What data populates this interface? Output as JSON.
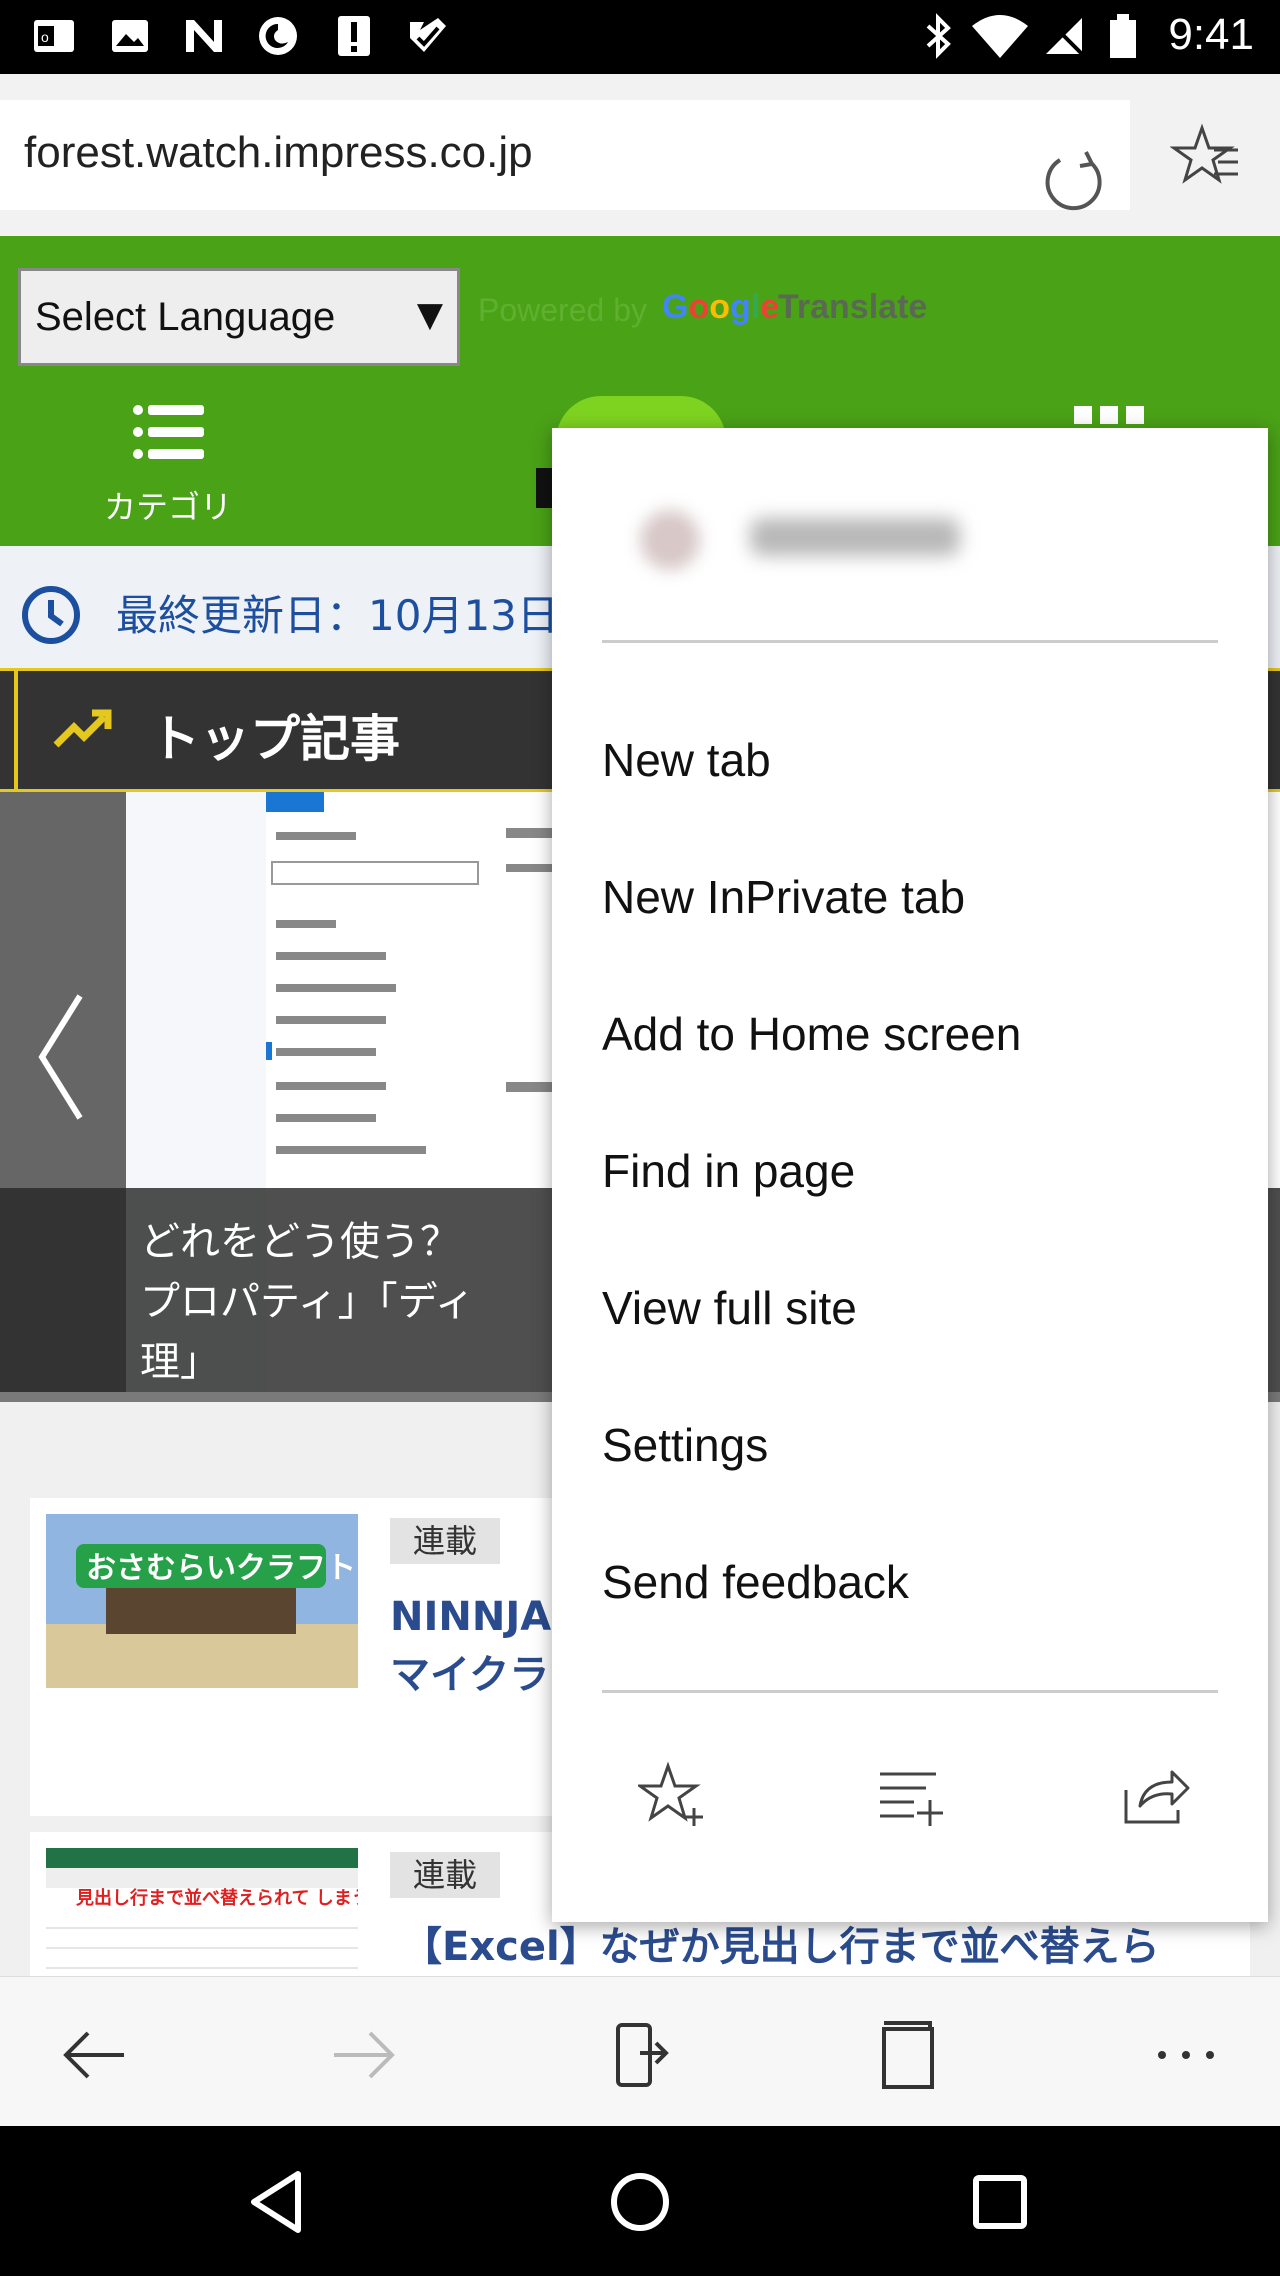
{
  "status_bar": {
    "time": "9:41",
    "left_icons": [
      "outlook-icon",
      "gallery-icon",
      "n-app-icon",
      "firefox-icon",
      "alert-icon",
      "check-icon"
    ],
    "right_icons": [
      "bluetooth-icon",
      "wifi-icon",
      "no-signal-icon",
      "battery-icon"
    ]
  },
  "browser": {
    "url": "forest.watch.impress.co.jp"
  },
  "page": {
    "language_select": "Select Language",
    "powered_by": "Powered by",
    "google": [
      "G",
      "o",
      "o",
      "g",
      "l",
      "e"
    ],
    "translate": "Translate",
    "category_label": "カテゴリ",
    "last_updated": "最終更新日：10月13日",
    "top_articles": "トップ記事",
    "carousel_caption": "どれをどう使う？\nプロパティ」「ディ\n理」",
    "articles": [
      {
        "tag": "連載",
        "title": "NINNJA\nマイクラ",
        "thumb_text": "おさむらいクラフト"
      },
      {
        "tag": "連載",
        "title": "【Excel】なぜか見出し行まで並べ替えら",
        "thumb_text": "見出し行まで並べ替えられて しまう！"
      }
    ]
  },
  "menu": {
    "items": [
      "New tab",
      "New InPrivate tab",
      "Add to Home screen",
      "Find in page",
      "View full site",
      "Settings",
      "Send feedback"
    ],
    "bottom_icons": [
      "add-favorite-icon",
      "add-reading-list-icon",
      "share-icon"
    ]
  },
  "toolbar": {
    "icons": [
      "back-icon",
      "forward-icon",
      "continue-on-pc-icon",
      "tabs-icon",
      "more-icon"
    ]
  },
  "nav": {
    "icons": [
      "nav-back-icon",
      "nav-home-icon",
      "nav-recents-icon"
    ]
  },
  "colors": {
    "header_green": "#4aa217",
    "accent_yellow": "#e5c81d",
    "link_blue": "#2a4b8d"
  }
}
